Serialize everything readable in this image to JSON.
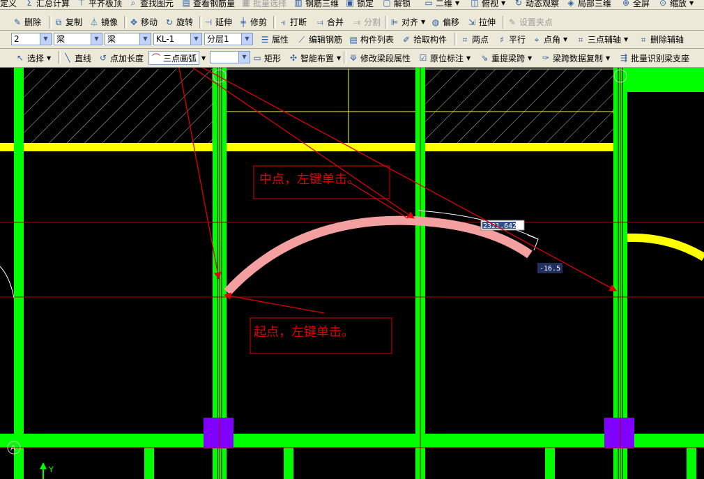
{
  "toolbar_row1": {
    "items": [
      {
        "label": "定义",
        "icon": "define-icon"
      },
      {
        "label": "汇总计算",
        "icon": "sum-icon"
      },
      {
        "label": "平齐板顶",
        "icon": "align-top-icon"
      },
      {
        "label": "查找图元",
        "icon": "find-icon"
      },
      {
        "label": "查看钢筋量",
        "icon": "view-rebar-icon"
      },
      {
        "label": "批量选择",
        "icon": "batch-select-icon"
      },
      {
        "label": "钢筋三维",
        "icon": "rebar-3d-icon"
      },
      {
        "label": "锁定",
        "icon": "lock-icon"
      },
      {
        "label": "解锁",
        "icon": "unlock-icon"
      },
      {
        "label": "二维",
        "icon": "2d-icon"
      },
      {
        "label": "俯视",
        "icon": "top-view-icon"
      },
      {
        "label": "动态观察",
        "icon": "orbit-icon"
      },
      {
        "label": "局部三维",
        "icon": "local-3d-icon"
      },
      {
        "label": "全屏",
        "icon": "fullscreen-icon"
      },
      {
        "label": "缩放",
        "icon": "zoom-icon"
      }
    ]
  },
  "toolbar_row2": {
    "items": [
      {
        "label": "删除",
        "icon": "delete-icon"
      },
      {
        "label": "复制",
        "icon": "copy-icon"
      },
      {
        "label": "镜像",
        "icon": "mirror-icon"
      },
      {
        "label": "移动",
        "icon": "move-icon"
      },
      {
        "label": "旋转",
        "icon": "rotate-icon"
      },
      {
        "label": "延伸",
        "icon": "extend-icon"
      },
      {
        "label": "修剪",
        "icon": "trim-icon"
      },
      {
        "label": "打断",
        "icon": "break-icon"
      },
      {
        "label": "合并",
        "icon": "merge-icon"
      },
      {
        "label": "分割",
        "icon": "split-icon"
      },
      {
        "label": "对齐",
        "icon": "align-icon"
      },
      {
        "label": "偏移",
        "icon": "offset-icon"
      },
      {
        "label": "拉伸",
        "icon": "stretch-icon"
      },
      {
        "label": "设置夹点",
        "icon": "grip-icon"
      }
    ]
  },
  "toolbar_row3": {
    "floor_select": "2",
    "type_select": "梁",
    "subtype_select": "梁",
    "member_select": "KL-1",
    "layer_select": "分层1",
    "items": [
      {
        "label": "属性",
        "icon": "properties-icon"
      },
      {
        "label": "编辑钢筋",
        "icon": "edit-rebar-icon"
      },
      {
        "label": "构件列表",
        "icon": "member-list-icon"
      },
      {
        "label": "拾取构件",
        "icon": "pick-member-icon"
      },
      {
        "label": "两点",
        "icon": "two-point-icon"
      },
      {
        "label": "平行",
        "icon": "parallel-icon"
      },
      {
        "label": "点角",
        "icon": "point-angle-icon"
      },
      {
        "label": "三点辅轴",
        "icon": "three-point-axis-icon"
      },
      {
        "label": "删除辅轴",
        "icon": "delete-axis-icon"
      }
    ]
  },
  "toolbar_row4": {
    "items": [
      {
        "label": "选择",
        "icon": "select-icon"
      },
      {
        "label": "直线",
        "icon": "line-icon"
      },
      {
        "label": "点加长度",
        "icon": "point-length-icon"
      },
      {
        "label": "三点画弧",
        "icon": "three-point-arc-icon"
      },
      {
        "label": "",
        "icon": ""
      },
      {
        "label": "矩形",
        "icon": "rectangle-icon"
      },
      {
        "label": "智能布置",
        "icon": "smart-layout-icon"
      },
      {
        "label": "修改梁段属性",
        "icon": "modify-segment-icon"
      },
      {
        "label": "原位标注",
        "icon": "in-place-label-icon"
      },
      {
        "label": "重提梁跨",
        "icon": "reextract-span-icon"
      },
      {
        "label": "梁跨数据复制",
        "icon": "span-data-copy-icon"
      },
      {
        "label": "批量识别梁支座",
        "icon": "batch-support-icon"
      }
    ]
  },
  "canvas": {
    "radius_input": "2321.642",
    "angle_readout": "-16.5",
    "axis_label_y": "Y",
    "axis_marker_a": "A",
    "callout_mid": "中点，左键单击。",
    "callout_start": "起点，左键单击。",
    "colors": {
      "column_green": "#00FF00",
      "beam_yellow": "#FFFF00",
      "arc_pink": "#F4A0A0",
      "annotation_red": "#E00000",
      "column_purple": "#8000FF"
    }
  }
}
